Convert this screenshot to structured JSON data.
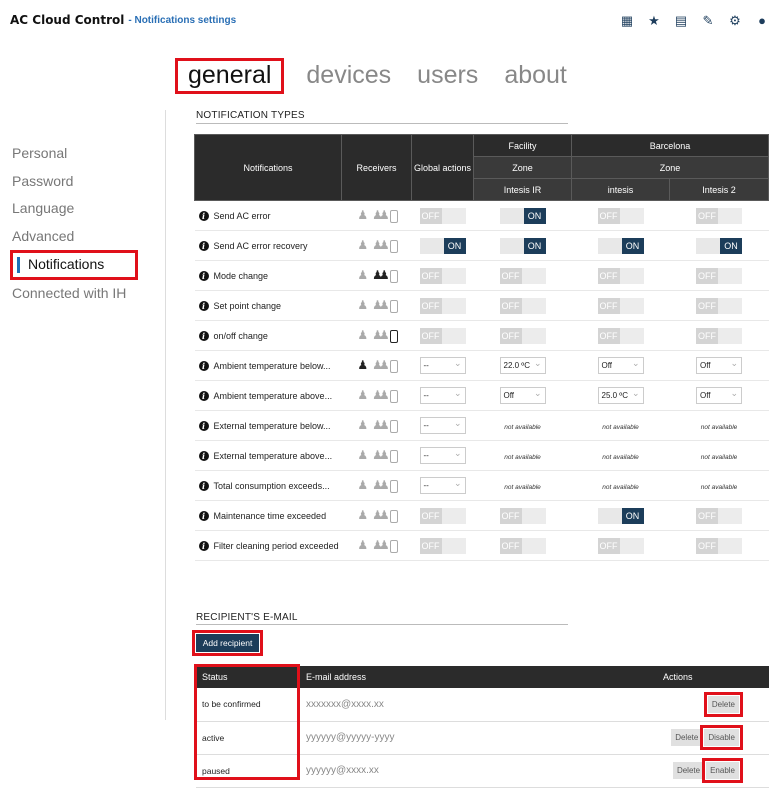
{
  "app": {
    "title": "AC Cloud Control",
    "subtitle": "- Notifications settings"
  },
  "top_icons": [
    "dashboard-icon",
    "star-icon",
    "calendar-icon",
    "wrench-icon",
    "gear-icon",
    "user-icon"
  ],
  "tabs": [
    {
      "label": "general",
      "active": true
    },
    {
      "label": "devices",
      "active": false
    },
    {
      "label": "users",
      "active": false
    },
    {
      "label": "about",
      "active": false
    }
  ],
  "side_menu": [
    {
      "label": "Personal",
      "active": false
    },
    {
      "label": "Password",
      "active": false
    },
    {
      "label": "Language",
      "active": false
    },
    {
      "label": "Advanced",
      "active": false
    },
    {
      "label": "Notifications",
      "active": true
    },
    {
      "label": "Connected with IH",
      "active": false
    }
  ],
  "notification_types": {
    "title": "NOTIFICATION TYPES",
    "headers": {
      "notifications": "Notifications",
      "receivers": "Receivers",
      "global": "Global actions",
      "facility": "Facility",
      "barcelona": "Barcelona",
      "zone1": "Zone",
      "zone2": "Zone",
      "dev1": "Intesis IR",
      "dev2": "intesis",
      "dev3": "Intesis 2"
    },
    "rows": [
      {
        "name": "Send AC error",
        "recv": [
          0,
          0,
          0
        ],
        "global": "OFF",
        "c1": "ON",
        "c2": "OFF",
        "c3": "OFF"
      },
      {
        "name": "Send AC error recovery",
        "recv": [
          0,
          0,
          0
        ],
        "global": "ON",
        "c1": "ON",
        "c2": "ON",
        "c3": "ON"
      },
      {
        "name": "Mode change",
        "recv": [
          0,
          1,
          0
        ],
        "global": "OFF",
        "c1": "OFF",
        "c2": "OFF",
        "c3": "OFF"
      },
      {
        "name": "Set point change",
        "recv": [
          0,
          0,
          0
        ],
        "global": "OFF",
        "c1": "OFF",
        "c2": "OFF",
        "c3": "OFF"
      },
      {
        "name": "on/off change",
        "recv": [
          0,
          0,
          1
        ],
        "global": "OFF",
        "c1": "OFF",
        "c2": "OFF",
        "c3": "OFF"
      },
      {
        "name": "Ambient temperature below...",
        "recv": [
          1,
          0,
          0
        ],
        "global": "sel:--",
        "c1": "sel:22.0 ºC",
        "c2": "sel:Off",
        "c3": "sel:Off"
      },
      {
        "name": "Ambient temperature above...",
        "recv": [
          0,
          0,
          0
        ],
        "global": "sel:--",
        "c1": "sel:Off",
        "c2": "sel:25.0 ºC",
        "c3": "sel:Off"
      },
      {
        "name": "External temperature below...",
        "recv": [
          0,
          0,
          0
        ],
        "global": "sel:--",
        "c1": "na:not available",
        "c2": "na:not available",
        "c3": "na:not available"
      },
      {
        "name": "External temperature above...",
        "recv": [
          0,
          0,
          0
        ],
        "global": "sel:--",
        "c1": "na:not available",
        "c2": "na:not available",
        "c3": "na:not available"
      },
      {
        "name": "Total consumption exceeds...",
        "recv": [
          0,
          0,
          0
        ],
        "global": "sel:--",
        "c1": "na:not available",
        "c2": "na:not available",
        "c3": "na:not available"
      },
      {
        "name": "Maintenance time exceeded",
        "recv": [
          0,
          0,
          0
        ],
        "global": "OFF",
        "c1": "OFF",
        "c2": "ON",
        "c3": "OFF"
      },
      {
        "name": "Filter cleaning period exceeded",
        "recv": [
          0,
          0,
          0
        ],
        "global": "OFF",
        "c1": "OFF",
        "c2": "OFF",
        "c3": "OFF"
      }
    ]
  },
  "recipients": {
    "title": "RECIPIENT'S E-MAIL",
    "add_label": "Add recipient",
    "headers": {
      "status": "Status",
      "email": "E-mail address",
      "actions": "Actions"
    },
    "rows": [
      {
        "status": "to be confirmed",
        "email": "xxxxxxx@xxxx.xx",
        "actions": [
          {
            "label": "Delete",
            "hl": true
          }
        ]
      },
      {
        "status": "active",
        "email": "yyyyyy@yyyyy-yyyy",
        "actions": [
          {
            "label": "Delete",
            "hl": false
          },
          {
            "label": "Disable",
            "hl": true
          }
        ]
      },
      {
        "status": "paused",
        "email": "yyyyyy@xxxx.xx",
        "actions": [
          {
            "label": "Delete",
            "hl": false
          },
          {
            "label": "Enable",
            "hl": true
          }
        ]
      }
    ]
  },
  "colors": {
    "accent": "#1c3d5a",
    "highlight": "#e0101a",
    "link": "#2a6fb5"
  }
}
